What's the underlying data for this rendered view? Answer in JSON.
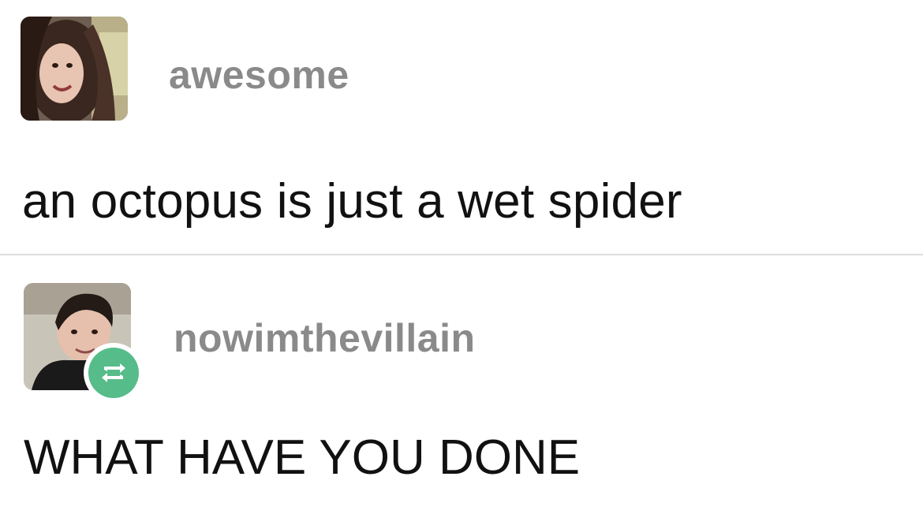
{
  "posts": [
    {
      "username": "awesome",
      "text": "an octopus is just a wet spider",
      "avatar_icon": "user-avatar-photo"
    },
    {
      "username": "nowimthevillain",
      "text": "WHAT HAVE YOU DONE",
      "avatar_icon": "user-avatar-photo",
      "badge_icon": "reblog-icon"
    }
  ],
  "colors": {
    "username": "#8a8a8a",
    "body_text": "#111111",
    "divider": "#dedede",
    "reblog_badge": "#56bc8a"
  }
}
